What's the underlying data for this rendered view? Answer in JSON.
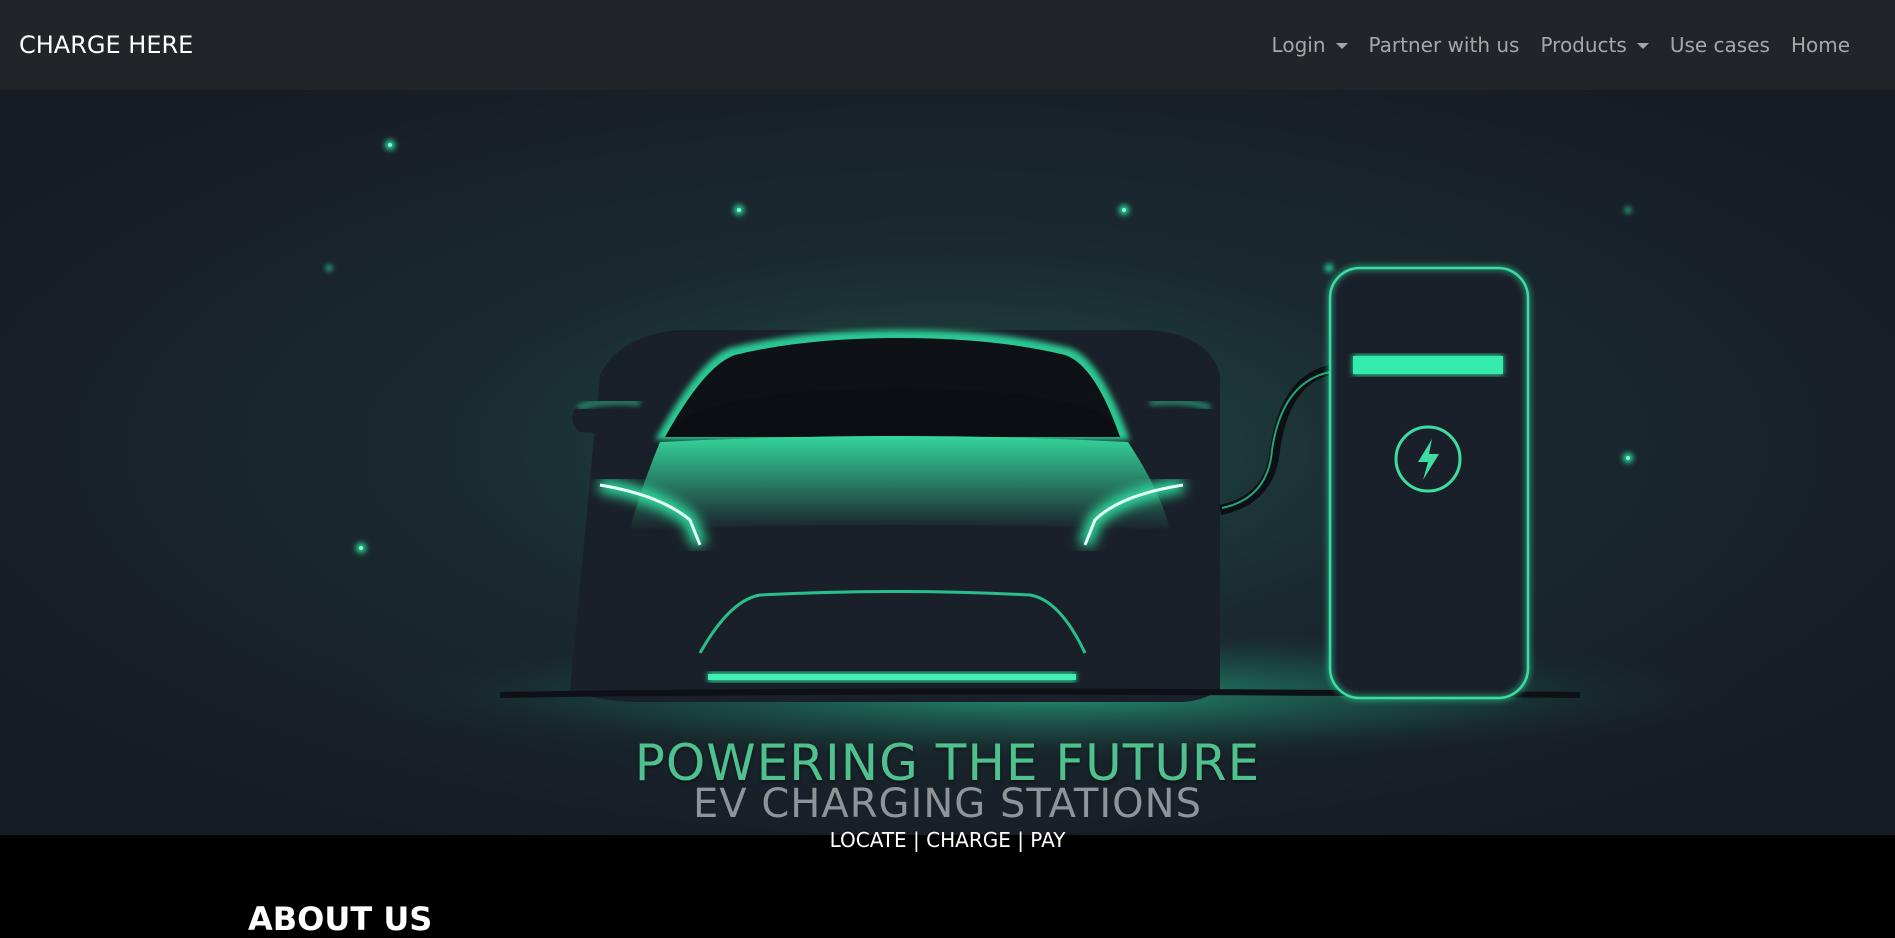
{
  "navbar": {
    "brand": "CHARGE HERE",
    "items": [
      {
        "label": "Login",
        "dropdown": true
      },
      {
        "label": "Partner with us",
        "dropdown": false
      },
      {
        "label": "Products",
        "dropdown": true
      },
      {
        "label": "Use cases",
        "dropdown": false
      },
      {
        "label": "Home",
        "dropdown": false
      }
    ]
  },
  "hero": {
    "title": "POWERING THE FUTURE",
    "subtitle": "EV CHARGING STATIONS",
    "tagline": "LOCATE | CHARGE | PAY"
  },
  "about": {
    "heading": "ABOUT US"
  },
  "colors": {
    "navbar_bg": "#212529",
    "accent_green": "#2ee6a6",
    "hero_bg": "#171b24"
  }
}
